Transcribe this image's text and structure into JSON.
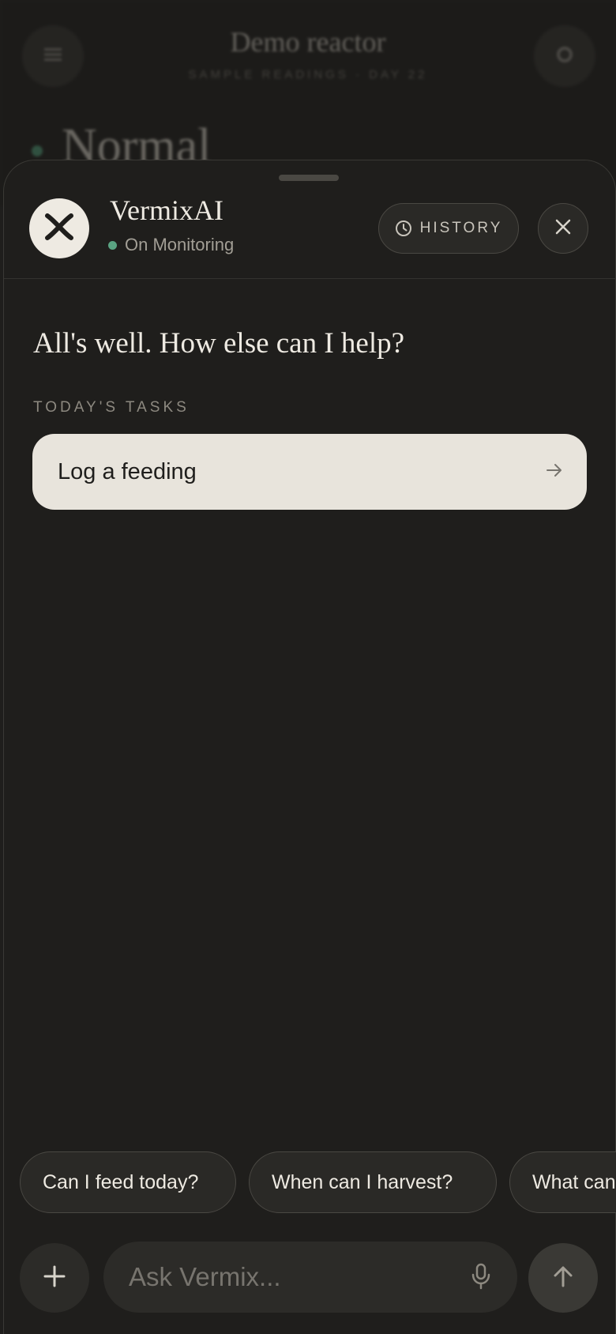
{
  "background": {
    "title": "Demo reactor",
    "subtitle": "SAMPLE READINGS · DAY 22",
    "status": "Normal",
    "menu_icon": "menu-icon",
    "settings_icon": "gear-icon"
  },
  "header": {
    "assistant_name": "VermixAI",
    "status_text": "On Monitoring",
    "status_color": "#5aa382",
    "history_label": "HISTORY",
    "history_icon": "clock-icon",
    "close_icon": "close-icon",
    "avatar_icon": "vermix-logo-icon"
  },
  "main": {
    "greeting": "All's well. How else can I help?",
    "tasks_heading": "TODAY'S TASKS",
    "tasks": [
      {
        "label": "Log a feeding",
        "icon": "arrow-right-icon"
      }
    ]
  },
  "suggestions": [
    "Can I feed today?",
    "When can I harvest?",
    "What can I do?"
  ],
  "composer": {
    "placeholder": "Ask Vermix...",
    "value": "",
    "add_icon": "plus-icon",
    "mic_icon": "microphone-icon",
    "send_icon": "arrow-up-icon"
  },
  "colors": {
    "background": "#1f1e1c",
    "card": "#e8e4dc",
    "accent_green": "#5aa382"
  }
}
